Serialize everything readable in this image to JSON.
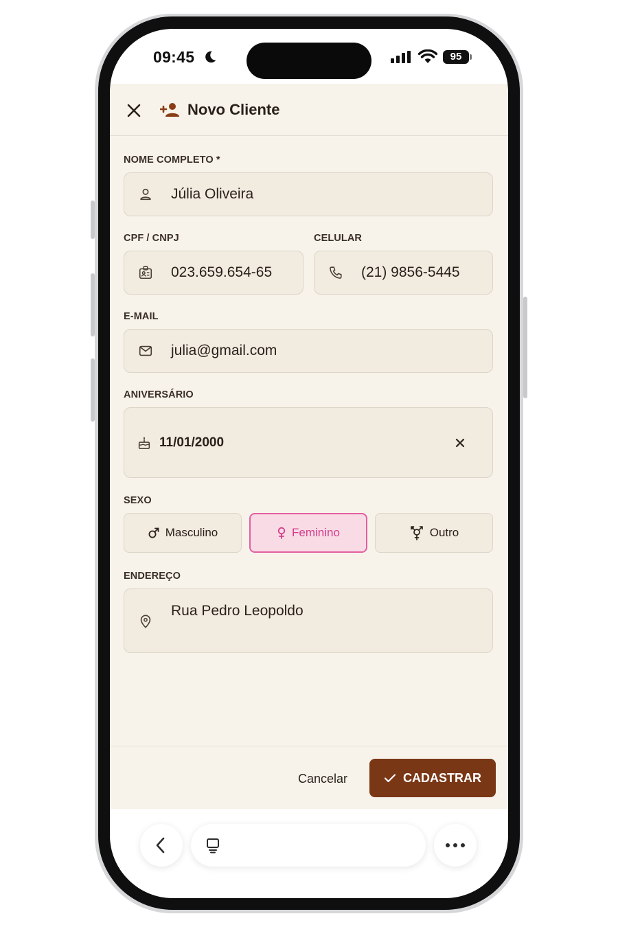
{
  "status_bar": {
    "time": "09:45",
    "battery": "95"
  },
  "header": {
    "title": "Novo Cliente"
  },
  "form": {
    "nome": {
      "label": "NOME COMPLETO *",
      "value": "Júlia Oliveira"
    },
    "cpf": {
      "label": "CPF / CNPJ",
      "value": "023.659.654-65"
    },
    "celular": {
      "label": "CELULAR",
      "value": "(21) 9856-5445"
    },
    "email": {
      "label": "E-MAIL",
      "value": "julia@gmail.com"
    },
    "aniversario": {
      "label": "ANIVERSÁRIO",
      "value": "11/01/2000"
    },
    "sexo": {
      "label": "SEXO",
      "options": [
        "Masculino",
        "Feminino",
        "Outro"
      ],
      "selected": "Feminino"
    },
    "endereco": {
      "label": "ENDEREÇO",
      "value": "Rua Pedro Leopoldo"
    }
  },
  "footer": {
    "cancel_label": "Cancelar",
    "submit_label": "CADASTRAR"
  },
  "colors": {
    "background": "#f7f3ea",
    "field_bg": "#f1ebe0",
    "accent_brown": "#7a3715",
    "selected_pink": "#d43d8b",
    "selected_pink_bg": "#f8dbe5"
  },
  "icons": [
    "close-icon",
    "add-person-icon",
    "person-icon",
    "id-card-icon",
    "phone-icon",
    "mail-icon",
    "cake-icon",
    "clear-icon",
    "male-icon",
    "female-icon",
    "transgender-icon",
    "location-pin-icon",
    "check-icon",
    "back-icon",
    "tabs-icon",
    "more-icon"
  ]
}
